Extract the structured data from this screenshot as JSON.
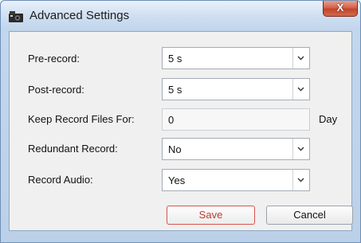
{
  "window": {
    "title": "Advanced Settings",
    "close_label": "X"
  },
  "form": {
    "pre_record": {
      "label": "Pre-record:",
      "value": "5 s"
    },
    "post_record": {
      "label": "Post-record:",
      "value": "5 s"
    },
    "keep_files": {
      "label": "Keep Record Files For:",
      "value": "0",
      "unit": "Day"
    },
    "redundant": {
      "label": "Redundant Record:",
      "value": "No"
    },
    "audio": {
      "label": "Record Audio:",
      "value": "Yes"
    }
  },
  "buttons": {
    "save": "Save",
    "cancel": "Cancel"
  },
  "icons": {
    "app": "camera-icon",
    "dropdown": "chevron-down-icon"
  }
}
